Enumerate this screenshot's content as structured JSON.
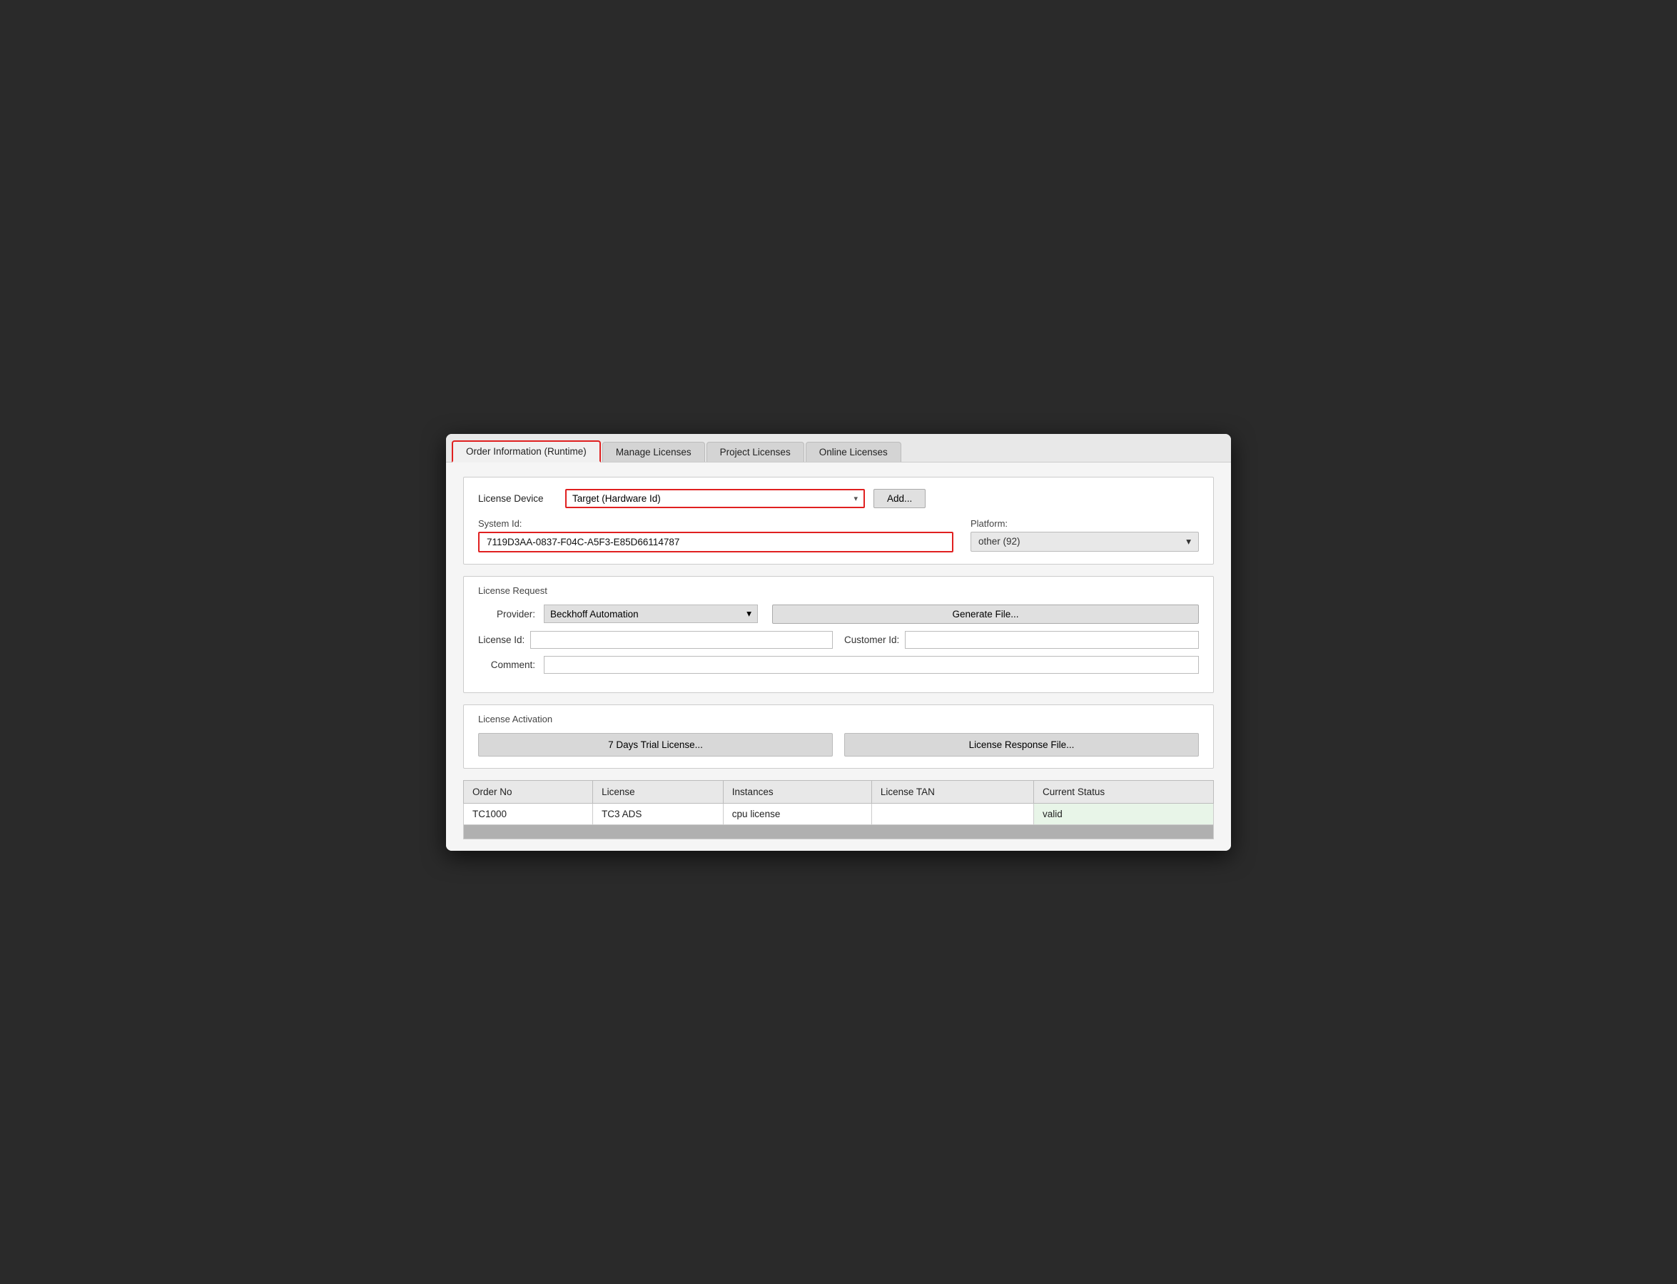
{
  "tabs": [
    {
      "id": "order-information",
      "label": "Order Information (Runtime)",
      "active": true
    },
    {
      "id": "manage-licenses",
      "label": "Manage Licenses",
      "active": false
    },
    {
      "id": "project-licenses",
      "label": "Project Licenses",
      "active": false
    },
    {
      "id": "online-licenses",
      "label": "Online Licenses",
      "active": false
    }
  ],
  "licenseDevice": {
    "label": "License Device",
    "selectValue": "Target (Hardware Id)",
    "addButtonLabel": "Add..."
  },
  "systemId": {
    "label": "System Id:",
    "value": "7119D3AA-0837-F04C-A5F3-E85D66114787"
  },
  "platform": {
    "label": "Platform:",
    "value": "other (92)"
  },
  "licenseRequest": {
    "sectionTitle": "License Request",
    "providerLabel": "Provider:",
    "providerValue": "Beckhoff Automation",
    "generateFileLabel": "Generate File...",
    "licenseIdLabel": "License Id:",
    "licenseIdValue": "",
    "customerIdLabel": "Customer Id:",
    "customerIdValue": "",
    "commentLabel": "Comment:",
    "commentValue": ""
  },
  "licenseActivation": {
    "sectionTitle": "License Activation",
    "trialLicenseLabel": "7 Days Trial License...",
    "responseFileLabel": "License Response File..."
  },
  "table": {
    "columns": [
      "Order No",
      "License",
      "Instances",
      "License TAN",
      "Current Status"
    ],
    "rows": [
      {
        "orderNo": "TC1000",
        "license": "TC3 ADS",
        "instances": "cpu license",
        "licenseTAN": "",
        "currentStatus": "valid",
        "statusClass": "td-valid"
      }
    ]
  },
  "chevronDown": "▾"
}
